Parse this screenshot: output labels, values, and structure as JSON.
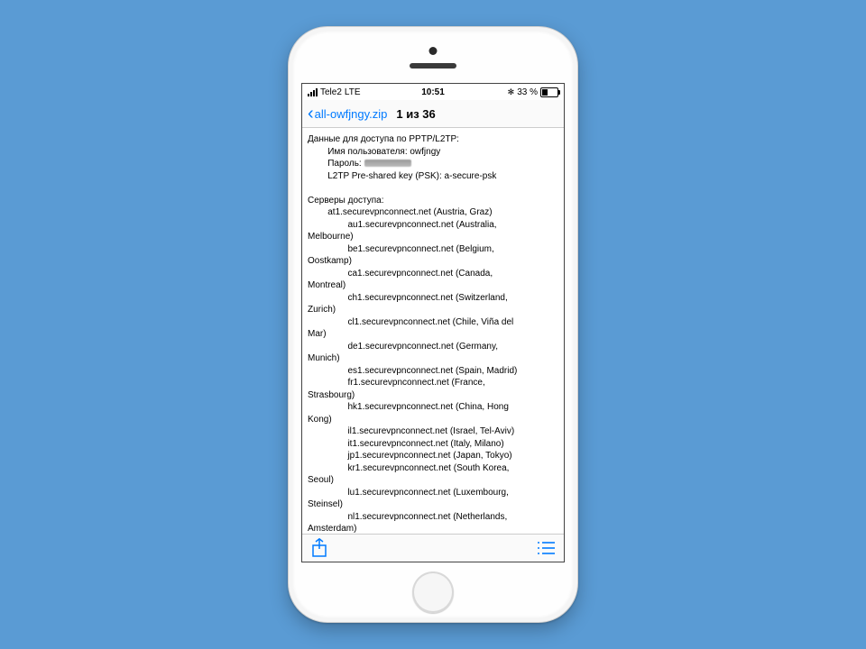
{
  "status": {
    "carrier": "Tele2",
    "network": "LTE",
    "time": "10:51",
    "bluetooth_glyph": "✻",
    "battery_text": "33 %"
  },
  "nav": {
    "back_label": "all-owfjngy.zip",
    "title": "1 из 36"
  },
  "doc": {
    "header": "Данные для доступа по PPTP/L2TP:",
    "username_line": "Имя пользователя: owfjngy",
    "password_prefix": "Пароль: ",
    "psk_line": "L2TP Pre-shared key (PSK): a-secure-psk",
    "servers_header": "Серверы доступа:",
    "s01": "at1.securevpnconnect.net (Austria, Graz)",
    "s02a": "au1.securevpnconnect.net (Australia,",
    "s02b": "Melbourne)",
    "s03a": "be1.securevpnconnect.net (Belgium,",
    "s03b": "Oostkamp)",
    "s04a": "ca1.securevpnconnect.net (Canada,",
    "s04b": "Montreal)",
    "s05a": "ch1.securevpnconnect.net (Switzerland,",
    "s05b": "Zurich)",
    "s06a": "cl1.securevpnconnect.net (Chile, Viña del",
    "s06b": "Mar)",
    "s07a": "de1.securevpnconnect.net (Germany,",
    "s07b": "Munich)",
    "s08": "es1.securevpnconnect.net (Spain, Madrid)",
    "s09a": "fr1.securevpnconnect.net (France,",
    "s09b": "Strasbourg)",
    "s10a": "hk1.securevpnconnect.net (China, Hong",
    "s10b": "Kong)",
    "s11": "il1.securevpnconnect.net (Israel, Tel-Aviv)",
    "s12": "it1.securevpnconnect.net (Italy, Milano)",
    "s13": "jp1.securevpnconnect.net (Japan, Tokyo)",
    "s14a": "kr1.securevpnconnect.net (South Korea,",
    "s14b": "Seoul)",
    "s15a": "lu1.securevpnconnect.net (Luxembourg,",
    "s15b": "Steinsel)",
    "s16a": "nl1.securevpnconnect.net (Netherlands,",
    "s16b": "Amsterdam)"
  },
  "indent": "        ",
  "indent2": "                "
}
